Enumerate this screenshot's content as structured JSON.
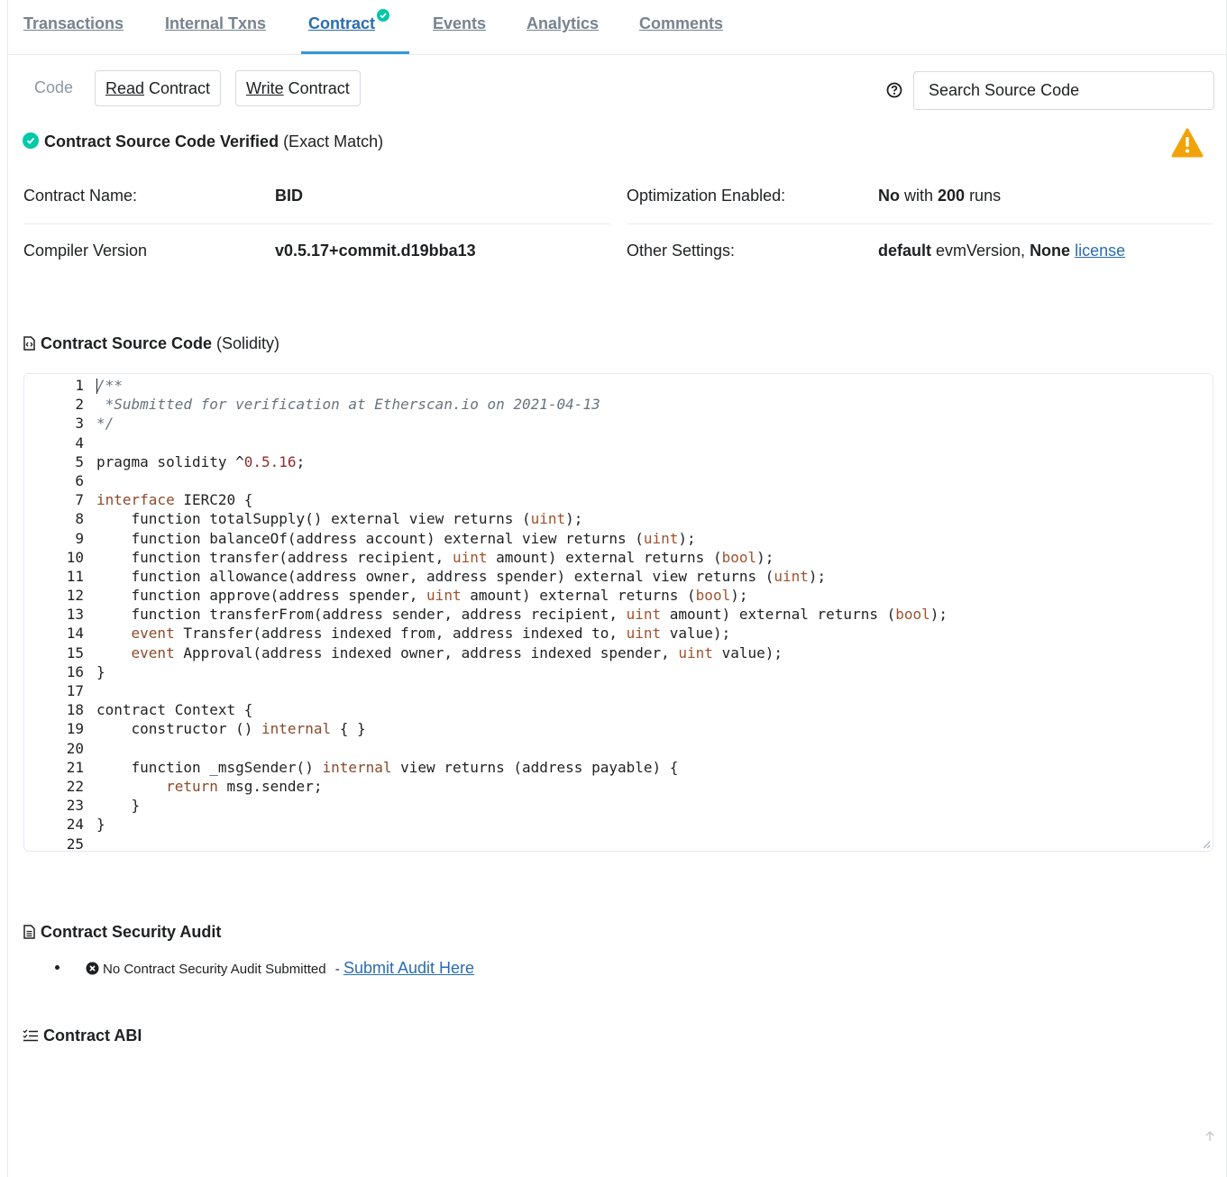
{
  "tabs": [
    {
      "label": "Transactions"
    },
    {
      "label": "Internal Txns"
    },
    {
      "label": "Contract"
    },
    {
      "label": "Events"
    },
    {
      "label": "Analytics"
    },
    {
      "label": "Comments"
    }
  ],
  "subnav": {
    "code": "Code",
    "read_u": "Read",
    "read_rest": " Contract",
    "write_u": "Write",
    "write_rest": " Contract"
  },
  "search": {
    "placeholder": "Search Source Code"
  },
  "verified": {
    "strong": "Contract Source Code Verified",
    "rest": " (Exact Match)"
  },
  "info": {
    "contract_name_label": "Contract Name:",
    "contract_name_value": "BID",
    "compiler_label": "Compiler Version",
    "compiler_value": "v0.5.17+commit.d19bba13",
    "optimization_label": "Optimization Enabled:",
    "optimization_value": "No",
    "optimization_with": " with ",
    "optimization_runs": "200",
    "optimization_runs_suffix": " runs",
    "other_label": "Other Settings:",
    "other_default": "default",
    "other_evm": " evmVersion, ",
    "other_none": "None",
    "other_license": "license"
  },
  "source_section": {
    "strong": "Contract Source Code",
    "rest": " (Solidity)"
  },
  "code_lines": [
    "/**",
    " *Submitted for verification at Etherscan.io on 2021-04-13",
    "*/",
    "",
    "pragma solidity ^0.5.16;",
    "",
    "interface IERC20 {",
    "    function totalSupply() external view returns (uint);",
    "    function balanceOf(address account) external view returns (uint);",
    "    function transfer(address recipient, uint amount) external returns (bool);",
    "    function allowance(address owner, address spender) external view returns (uint);",
    "    function approve(address spender, uint amount) external returns (bool);",
    "    function transferFrom(address sender, address recipient, uint amount) external returns (bool);",
    "    event Transfer(address indexed from, address indexed to, uint value);",
    "    event Approval(address indexed owner, address indexed spender, uint value);",
    "}",
    "",
    "contract Context {",
    "    constructor () internal { }",
    "",
    "    function _msgSender() internal view returns (address payable) {",
    "        return msg.sender;",
    "    }",
    "}",
    ""
  ],
  "audit": {
    "title": "Contract Security Audit",
    "item": "No Contract Security Audit Submitted",
    "sep": " - ",
    "link": "Submit Audit Here"
  },
  "abi": {
    "title": "Contract ABI"
  },
  "colors": {
    "accent": "#3498db",
    "success": "#00c9a7",
    "warning": "#f0a30a"
  }
}
